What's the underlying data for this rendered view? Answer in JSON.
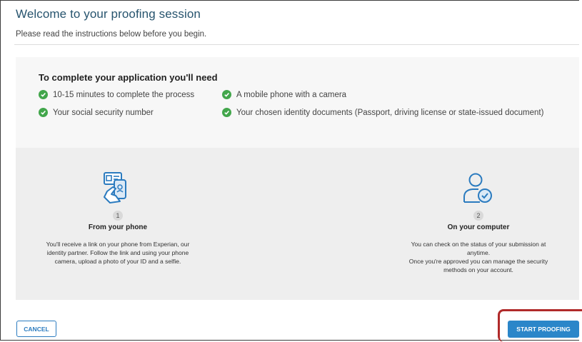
{
  "header": {
    "title": "Welcome to your proofing session",
    "subtitle": "Please read the instructions below before you begin."
  },
  "requirements": {
    "heading": "To complete your application you'll need",
    "items": [
      "10-15 minutes to complete the process",
      "A mobile phone with a camera",
      "Your social security number",
      "Your chosen identity documents (Passport, driving license or state-issued document)"
    ]
  },
  "steps": [
    {
      "number": "1",
      "title": "From your phone",
      "description": "You'll receive a link on your phone from Experian, our identity partner. Follow the link and using your phone camera, upload a photo of your ID and a selfie.",
      "icon": "phone-id-icon"
    },
    {
      "number": "2",
      "title": "On your computer",
      "description_line1": "You can check on the status of your submission at anytime.",
      "description_line2": "Once you're approved you can manage the security methods on your account.",
      "icon": "user-check-icon"
    }
  ],
  "actions": {
    "cancel_label": "CANCEL",
    "start_label": "START PROOFING"
  },
  "colors": {
    "title": "#27546e",
    "check": "#42a64b",
    "primary": "#2b86c9",
    "highlight": "#b02a2a"
  }
}
